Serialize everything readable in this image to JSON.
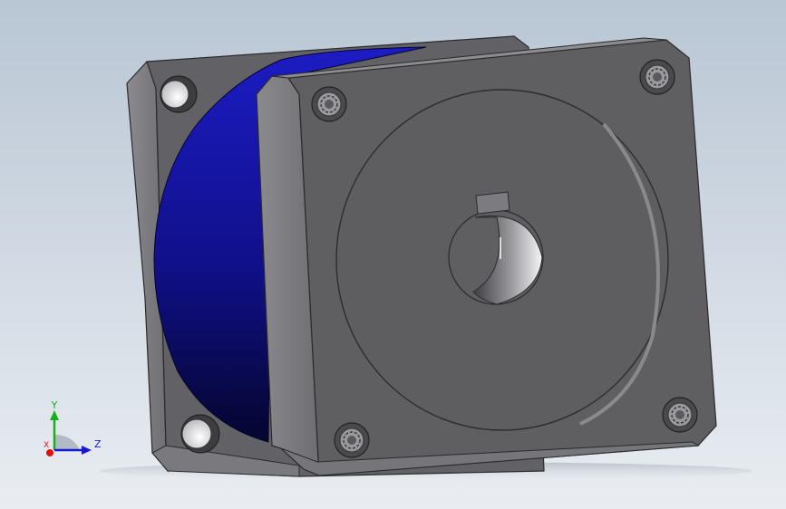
{
  "viewport": {
    "background_top": "#b9c6d4",
    "background_bottom": "#e9edf2"
  },
  "model": {
    "plate_color": "#5f5f62",
    "plate_edge_color": "#8e8e92",
    "body_color": "#1a1ab4",
    "body_dark": "#07073a"
  },
  "triad": {
    "x_label": "X",
    "y_label": "Y",
    "z_label": "Z",
    "x_color": "#e01010",
    "y_color": "#18b018",
    "z_color": "#1818d0"
  }
}
